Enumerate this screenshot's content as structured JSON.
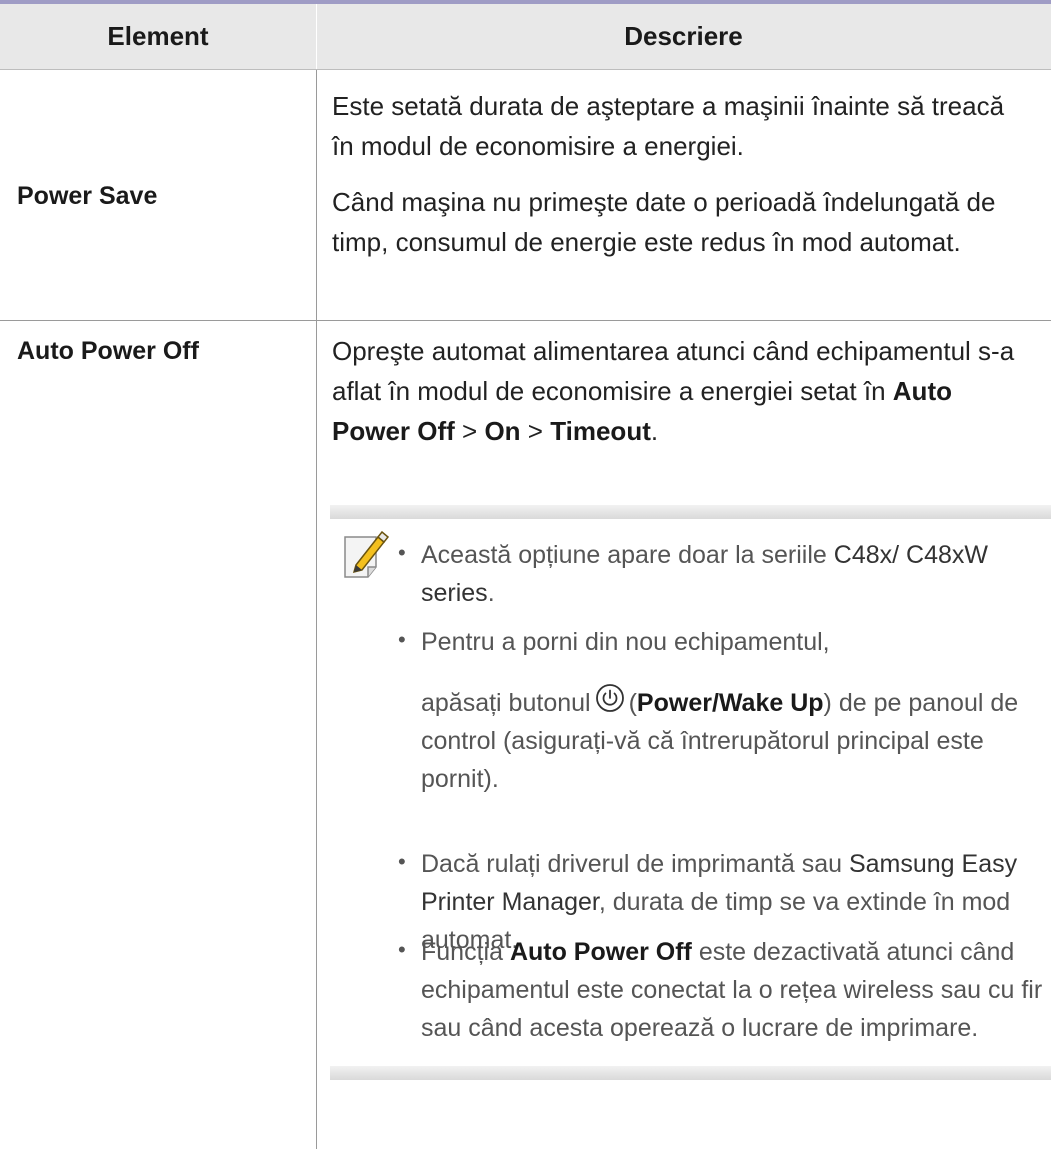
{
  "header": {
    "col_element": "Element",
    "col_description": "Descriere"
  },
  "rows": [
    {
      "label": "Power Save",
      "paragraphs": [
        "Este setată durata de aşteptare a maşinii înainte să treacă în modul de economisire a energiei.",
        "Când maşina nu primeşte date o perioadă îndelungată de timp, consumul de energie este redus în mod automat."
      ]
    },
    {
      "label": "Auto Power Off",
      "description_prefix": "Opreşte automat alimentarea atunci când echipamentul s-a aflat în modul de economisire a energiei setat în",
      "path_1": "Auto Power Off",
      "path_sep": ">",
      "path_2": "On",
      "path_3": "Timeout",
      "path_end": "."
    }
  ],
  "note": {
    "icon": "note-pencil-icon",
    "bullets": [
      {
        "a": "Această opțiune apare doar la seriile",
        "b": "C48x/ C48xW series",
        "c": "."
      },
      {
        "a": "Pentru a porni din nou echipamentul,",
        "b": "apăsați butonul",
        "icon": "power-icon",
        "c": "(",
        "d": "Power/Wake Up",
        "e": ") de pe panoul de control (asigurați-vă că întrerupătorul principal este pornit)."
      },
      {
        "a": "Dacă rulați driverul de imprimantă sau",
        "b": "Samsung Easy Printer Manager",
        "c": ", durata de timp se va extinde în mod automat."
      },
      {
        "a": "Funcția",
        "b": "Auto Power Off",
        "c": "este dezactivată atunci când echipamentul este conectat la o rețea wireless sau cu fir sau când acesta operează o lucrare de imprimare."
      }
    ]
  }
}
